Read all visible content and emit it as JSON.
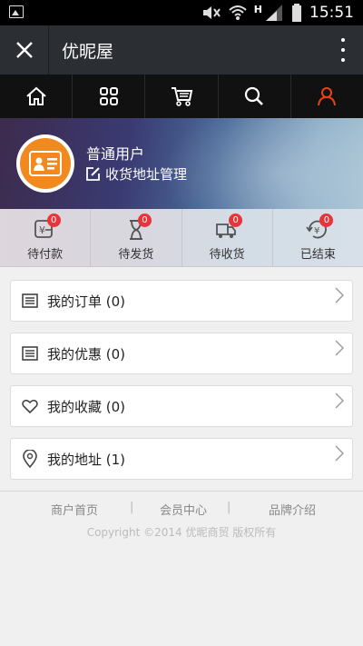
{
  "statusbar": {
    "time": "15:51",
    "network": "H"
  },
  "titlebar": {
    "title": "优昵屋"
  },
  "nav": {
    "items": [
      {
        "icon": "home-icon"
      },
      {
        "icon": "grid-icon"
      },
      {
        "icon": "cart-icon"
      },
      {
        "icon": "search-icon"
      },
      {
        "icon": "user-icon",
        "active": true
      }
    ],
    "active_color": "#e8431b"
  },
  "profile": {
    "username": "普通用户",
    "address_link": "收货地址管理"
  },
  "order_status": [
    {
      "label": "待付款",
      "count": "0",
      "icon": "payment-icon"
    },
    {
      "label": "待发货",
      "count": "0",
      "icon": "hourglass-icon"
    },
    {
      "label": "待收货",
      "count": "0",
      "icon": "truck-icon"
    },
    {
      "label": "已结束",
      "count": "0",
      "icon": "refund-icon"
    }
  ],
  "menu": [
    {
      "label": "我的订单 (0)",
      "icon": "list-icon"
    },
    {
      "label": "我的优惠 (0)",
      "icon": "list-icon"
    },
    {
      "label": "我的收藏 (0)",
      "icon": "heart-icon"
    },
    {
      "label": "我的地址 (1)",
      "icon": "location-icon"
    }
  ],
  "footer": {
    "links": [
      "商户首页",
      "会员中心",
      "品牌介绍"
    ],
    "separators": [
      "|",
      "|"
    ],
    "copyright": "Copyright ©2014 优昵商贸 版权所有"
  },
  "colors": {
    "badge": "#e8353b",
    "avatar": "#f08a1e",
    "nav_bg": "#111111",
    "title_bg": "#2b2e33"
  }
}
